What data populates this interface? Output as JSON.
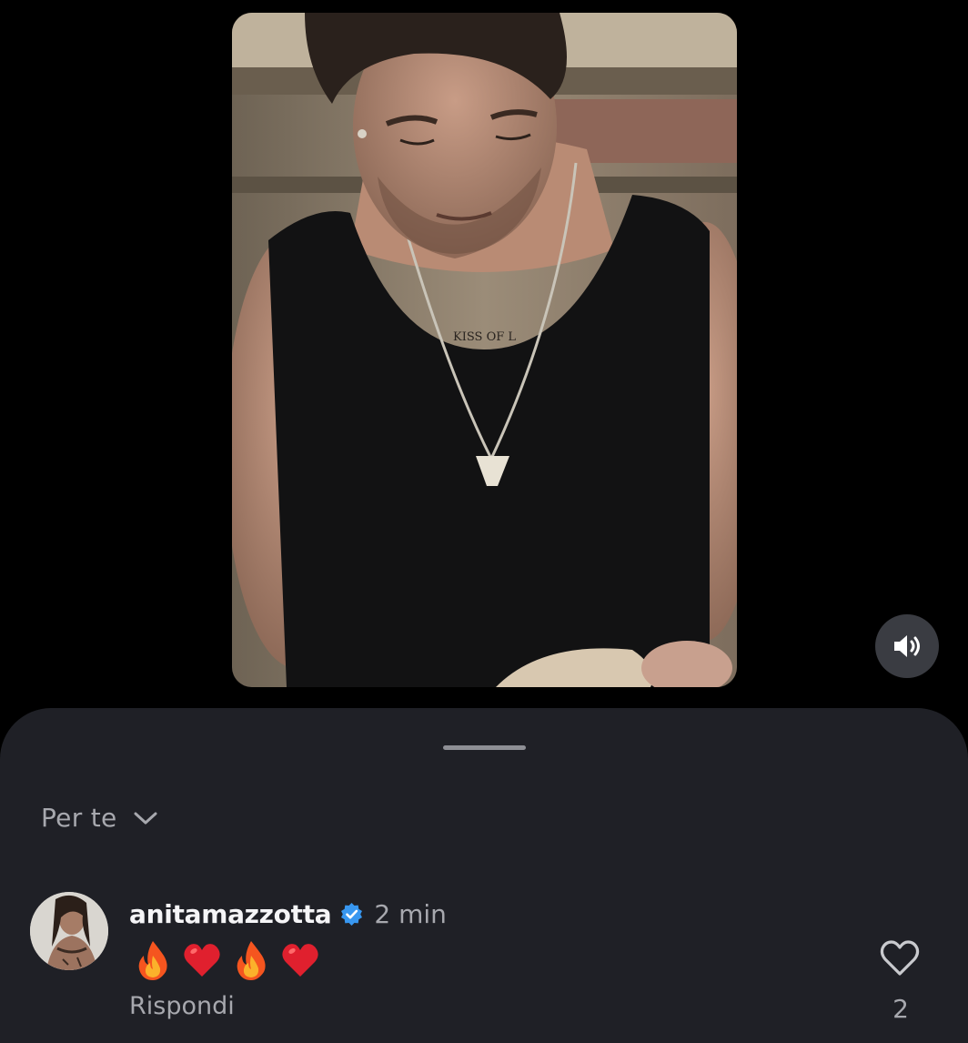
{
  "video": {
    "tattoo_text": "KISS OF L"
  },
  "sheet": {
    "filter_label": "Per te",
    "filter_icon": "chevron-down-icon"
  },
  "comment": {
    "username": "anitamazzotta",
    "verified": true,
    "time": "2 min",
    "emojis": [
      "fire",
      "red-heart",
      "fire",
      "red-heart"
    ],
    "reply_label": "Rispondi",
    "like_count": "2"
  },
  "colors": {
    "background": "#000000",
    "sheet": "#1f2026",
    "primary_text": "#f5f5f7",
    "secondary_text": "#a7a8ae",
    "verified_blue": "#3897f0"
  }
}
